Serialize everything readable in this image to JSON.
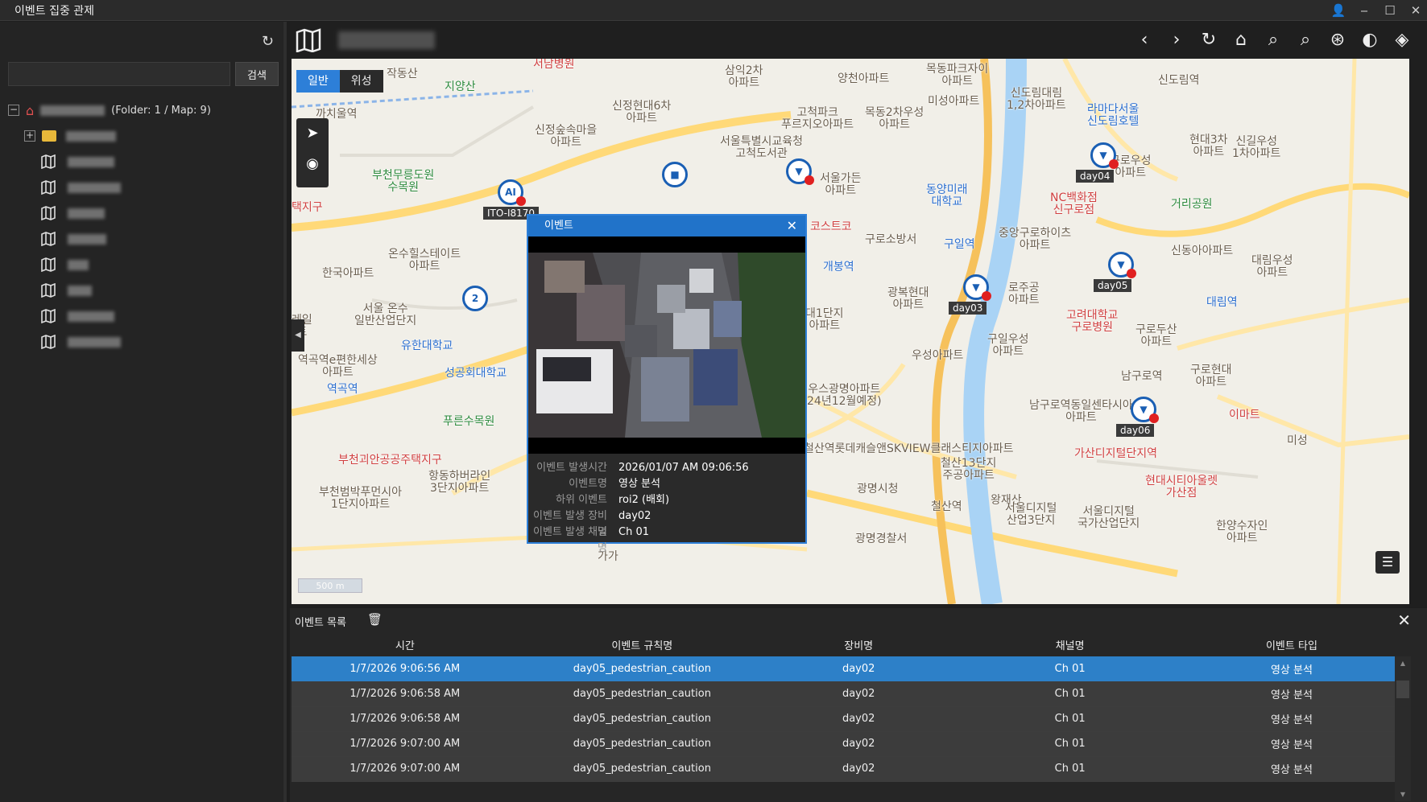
{
  "window": {
    "title": "이벤트 집중 관제"
  },
  "left_panel": {
    "search_button": "검색",
    "root": {
      "suffix": "(Folder: 1 / Map: 9)"
    }
  },
  "map": {
    "type_tabs": [
      "일반",
      "위성"
    ],
    "scale_label": "500 m",
    "labels": [
      "서남병원",
      "작동산",
      "지양산",
      "삼익2차\n아파트",
      "양천아파트",
      "목동파크자이\n아파트",
      "신도림대림\n1,2차아파트",
      "신도림역",
      "까치울역",
      "신정현대6차\n아파트",
      "신정숲속마을\n아파트",
      "고척파크\n푸르지오아파트",
      "목동2차우성\n아파트",
      "미성아파트",
      "라마다서울\n신도림호텔",
      "현대3차\n아파트",
      "신길우성\n1차아파트",
      "부천무릉도원\n수목원",
      "서울특별시교육청\n고척도서관",
      "서울가든\n아파트",
      "동양미래\n대학교",
      "구로우성\n아파트",
      "NC백화점\n신구로점",
      "거리공원",
      "온수힐스테이트\n아파트",
      "한국아파트",
      "코스트코",
      "구로소방서",
      "구일역",
      "중앙구로하이츠\n아파트",
      "신동아아파트",
      "대림우성\n아파트",
      "개봉역",
      "광복현대\n아파트",
      "로주공\n아파트",
      "고려대학교\n구로병원",
      "대림역",
      "서울 온수\n일반산업단지",
      "유한대학교",
      "역곡역e편한세상\n아파트",
      "성공회대학교",
      "구로두산\n아파트",
      "구일우성\n아파트",
      "우성아파트",
      "역곡역",
      "남구로역",
      "구로현대\n아파트",
      "푸른수목원",
      "우스광명아파트\n24년12월예정)",
      "남구로역동일센타시아\n아파트",
      "이마트",
      "미성",
      "부천괴안공공주택지구",
      "항동하버라인\n3단지아파트",
      "철산역롯데캐슬앤SKVIEW클래스티지아파트",
      "가산디지털단지역",
      "부천범박푸먼시아\n1단지아파트",
      "철산13단지\n주공아파트",
      "현대시티아울렛\n가산점",
      "광명시청",
      "철산역",
      "왕재산",
      "서울디지털\n산업3단지",
      "서울디지털\n국가산업단지",
      "한양수자인\n아파트",
      "광명경찰서",
      "택지구",
      "대1단지\n아파트",
      "레일\n트",
      "가가"
    ],
    "cameras": [
      {
        "tag": "ITO-I8170",
        "glyph": "AI"
      },
      {
        "tag": "",
        "glyph": "2"
      },
      {
        "tag": "day04",
        "glyph": "▼"
      },
      {
        "tag": "day05",
        "glyph": "▼"
      },
      {
        "tag": "day03",
        "glyph": "▼"
      },
      {
        "tag": "day06",
        "glyph": "▼"
      },
      {
        "tag": "",
        "glyph": "▼"
      },
      {
        "tag": "",
        "glyph": "■"
      }
    ]
  },
  "popup": {
    "title": "이벤트",
    "fields": [
      {
        "k": "이벤트 발생시간",
        "v": "2026/01/07 AM 09:06:56"
      },
      {
        "k": "이벤트명",
        "v": "영상 분석"
      },
      {
        "k": "하위 이벤트",
        "v": "roi2 (배회)"
      },
      {
        "k": "이벤트 발생 장비명",
        "v": "day02"
      },
      {
        "k": "이벤트 발생 채널명",
        "v": "Ch 01"
      }
    ]
  },
  "event_list": {
    "title": "이벤트 목록",
    "columns": [
      "시간",
      "이벤트 규칙명",
      "장비명",
      "채널명",
      "이벤트 타입"
    ],
    "rows": [
      [
        "1/7/2026 9:06:56 AM",
        "day05_pedestrian_caution",
        "day02",
        "Ch 01",
        "영상 분석"
      ],
      [
        "1/7/2026 9:06:58 AM",
        "day05_pedestrian_caution",
        "day02",
        "Ch 01",
        "영상 분석"
      ],
      [
        "1/7/2026 9:06:58 AM",
        "day05_pedestrian_caution",
        "day02",
        "Ch 01",
        "영상 분석"
      ],
      [
        "1/7/2026 9:07:00 AM",
        "day05_pedestrian_caution",
        "day02",
        "Ch 01",
        "영상 분석"
      ],
      [
        "1/7/2026 9:07:00 AM",
        "day05_pedestrian_caution",
        "day02",
        "Ch 01",
        "영상 분석"
      ]
    ]
  },
  "colors": {
    "accent": "#2d7fd8",
    "alarm": "#e02020",
    "camera": "#1a5fb4"
  }
}
